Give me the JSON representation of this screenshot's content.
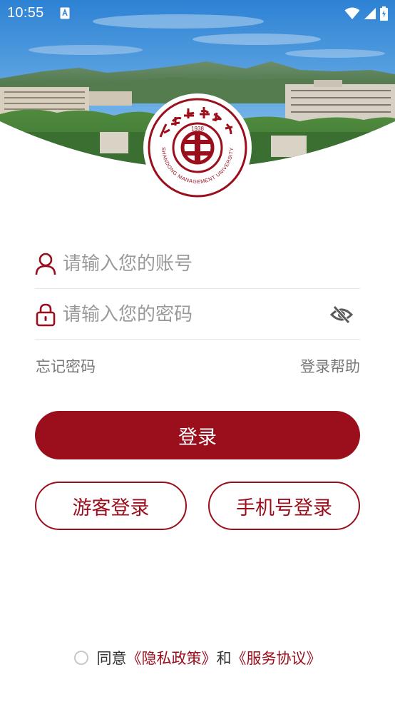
{
  "status_bar": {
    "time": "10:55"
  },
  "login": {
    "username_placeholder": "请输入您的账号",
    "password_placeholder": "请输入您的密码",
    "forgot_password": "忘记密码",
    "login_help": "登录帮助",
    "login_button": "登录",
    "guest_login_button": "游客登录",
    "phone_login_button": "手机号登录"
  },
  "agreement": {
    "agree_text": "同意",
    "privacy_policy": "《隐私政策》",
    "and_text": "和",
    "service_agreement": "《服务协议》"
  },
  "emblem": {
    "year": "1938",
    "university_name_en": "SHANDONG MANAGEMENT UNIVERSITY",
    "university_name_zh": "山东管理学院"
  },
  "colors": {
    "brand": "#9b0e1c",
    "placeholder": "#9a9a9a",
    "link": "#777777",
    "divider": "#e6e6e6"
  },
  "icons": {
    "user": "user-icon",
    "lock": "lock-icon",
    "password_visibility": "eye-off-icon",
    "wifi": "wifi-icon",
    "signal": "signal-icon",
    "battery": "battery-icon"
  }
}
